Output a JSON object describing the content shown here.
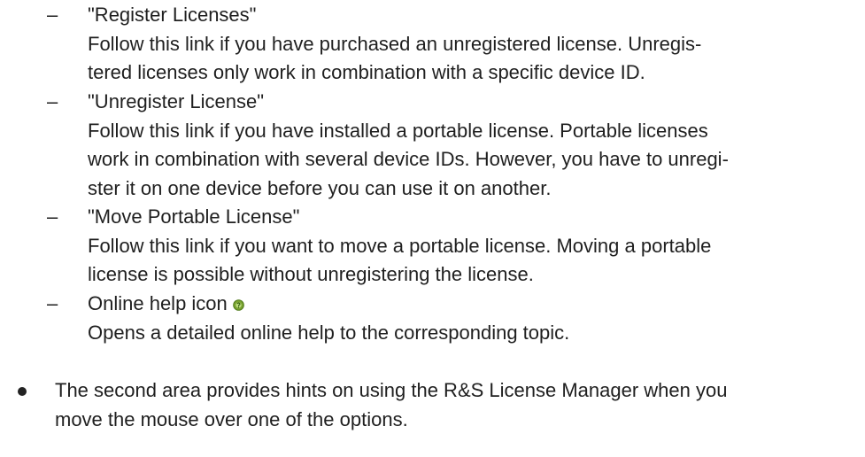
{
  "items": [
    {
      "title": "\"Register Licenses\"",
      "desc_lines": [
        "Follow this link if you have purchased an unregistered license. Unregis-",
        "tered licenses only work in combination with a specific device ID."
      ]
    },
    {
      "title": "\"Unregister License\"",
      "desc_lines": [
        "Follow this link if you have installed a portable license. Portable licenses",
        "work in combination with several device IDs. However, you have to unregi-",
        "ster it on one device before you can use it on another."
      ]
    },
    {
      "title": "\"Move Portable License\"",
      "desc_lines": [
        "Follow this link if you want to move a portable license. Moving a portable",
        "license is possible without unregistering the license."
      ]
    },
    {
      "title": "Online help icon",
      "icon": "help-icon",
      "desc_lines": [
        "Opens a detailed online help to the corresponding topic."
      ]
    }
  ],
  "dash_char": "–",
  "bullet": {
    "lines": [
      "The second area provides hints on using the R&S License Manager when you",
      "move the mouse over one of the options."
    ]
  },
  "colors": {
    "text": "#1f1f1f",
    "help_icon_fill": "#7aa330",
    "help_icon_border": "#4f7a1a"
  }
}
